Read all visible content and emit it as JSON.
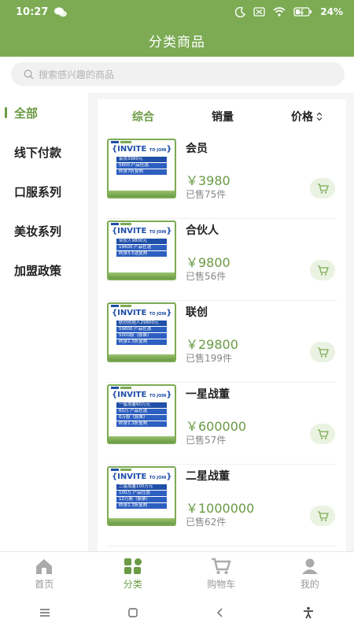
{
  "status": {
    "time": "10:27",
    "battery": "24"
  },
  "header": {
    "title": "分类商品"
  },
  "search": {
    "placeholder": "搜索感兴趣的商品"
  },
  "sidebar": {
    "items": [
      {
        "label": "全部",
        "active": true
      },
      {
        "label": "线下付款"
      },
      {
        "label": "口服系列"
      },
      {
        "label": "美妆系列"
      },
      {
        "label": "加盟政策"
      }
    ]
  },
  "sort": {
    "overall": "综合",
    "sales": "销量",
    "price": "价格"
  },
  "products": [
    {
      "name": "会员",
      "price": "￥3980",
      "sold": "已售75件",
      "thumb": {
        "line1": "会员3980元",
        "line2": "5600 产品任选",
        "line3": "终身7折复购"
      }
    },
    {
      "name": "合伙人",
      "price": "￥9800",
      "sold": "已售56件",
      "thumb": {
        "line1": "合伙人9800元",
        "line2": "19600 产品任选",
        "line3": "终身3.5送复购"
      }
    },
    {
      "name": "联创",
      "price": "￥29800",
      "sold": "已售199件",
      "thumb": {
        "line1": "联创创始人29800元",
        "line2": "59800 产品任选",
        "line3": "5000股（股票）",
        "line4": "终身2.3折复购"
      }
    },
    {
      "name": "一星战董",
      "price": "￥600000",
      "sold": "已售57件",
      "thumb": {
        "line1": "一星战董60万元",
        "line2": "60万 产品任选",
        "line3": "6万股（股票）",
        "line4": "终身2.3折复购"
      }
    },
    {
      "name": "二星战董",
      "price": "￥1000000",
      "sold": "已售62件",
      "thumb": {
        "line1": "二星战董100万元",
        "line2": "100万 产品任选",
        "line3": "12万股（股票）",
        "line4": "终身2.3折复购"
      }
    }
  ],
  "thumb_brand": "INVITE",
  "thumb_sub": "TO JOIN",
  "tabs": [
    {
      "label": "首页",
      "icon": "home-icon"
    },
    {
      "label": "分类",
      "icon": "category-icon",
      "active": true
    },
    {
      "label": "购物车",
      "icon": "cart-icon"
    },
    {
      "label": "我的",
      "icon": "user-icon"
    }
  ],
  "colors": {
    "accent": "#7cab54",
    "accent_text": "#6a9a44",
    "thumb_blue": "#1f4fa8"
  }
}
